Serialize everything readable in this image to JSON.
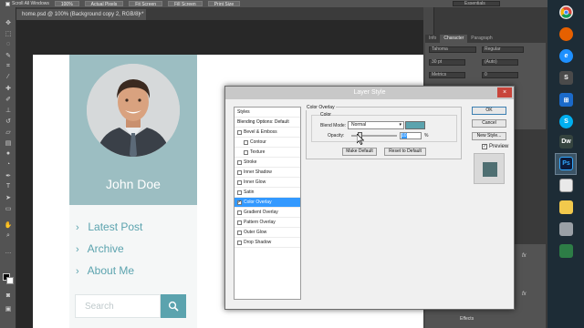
{
  "options_bar": {
    "scroll_all_windows": "Scroll All Windows",
    "buttons": [
      "100%",
      "Actual Pixels",
      "Fit Screen",
      "Fill Screen",
      "Print Size"
    ],
    "workspace": "Essentials"
  },
  "document_tab": {
    "title": "home.psd @ 100% (Background copy 2, RGB/8) *",
    "close": "×"
  },
  "canvas": {
    "profile_name": "John Doe",
    "nav": [
      "Latest Post",
      "Archive",
      "About Me"
    ],
    "search_placeholder": "Search",
    "accent_color": "#5ba3ae"
  },
  "panels": {
    "tabs": [
      "Info",
      "Character",
      "Paragraph"
    ],
    "font_family": "Tahoma",
    "font_style": "Regular",
    "fields": [
      "30 pt",
      "(Auto)",
      "Metrics",
      "0"
    ],
    "effects_label": "Effects",
    "fx": "fx"
  },
  "dialog": {
    "title": "Layer Style",
    "close": "×",
    "styles": [
      {
        "label": "Styles",
        "checkbox": false,
        "checked": false,
        "indent": false,
        "selected": false
      },
      {
        "label": "Blending Options: Default",
        "checkbox": false,
        "checked": false,
        "indent": false,
        "selected": false
      },
      {
        "label": "Bevel & Emboss",
        "checkbox": true,
        "checked": false,
        "indent": false,
        "selected": false
      },
      {
        "label": "Contour",
        "checkbox": true,
        "checked": false,
        "indent": true,
        "selected": false
      },
      {
        "label": "Texture",
        "checkbox": true,
        "checked": false,
        "indent": true,
        "selected": false
      },
      {
        "label": "Stroke",
        "checkbox": true,
        "checked": false,
        "indent": false,
        "selected": false
      },
      {
        "label": "Inner Shadow",
        "checkbox": true,
        "checked": false,
        "indent": false,
        "selected": false
      },
      {
        "label": "Inner Glow",
        "checkbox": true,
        "checked": false,
        "indent": false,
        "selected": false
      },
      {
        "label": "Satin",
        "checkbox": true,
        "checked": false,
        "indent": false,
        "selected": false
      },
      {
        "label": "Color Overlay",
        "checkbox": true,
        "checked": true,
        "indent": false,
        "selected": true
      },
      {
        "label": "Gradient Overlay",
        "checkbox": true,
        "checked": false,
        "indent": false,
        "selected": false
      },
      {
        "label": "Pattern Overlay",
        "checkbox": true,
        "checked": false,
        "indent": false,
        "selected": false
      },
      {
        "label": "Outer Glow",
        "checkbox": true,
        "checked": false,
        "indent": false,
        "selected": false
      },
      {
        "label": "Drop Shadow",
        "checkbox": true,
        "checked": false,
        "indent": false,
        "selected": false
      }
    ],
    "color_overlay": {
      "group_title": "Color Overlay",
      "color_title": "Color",
      "blend_mode_label": "Blend Mode:",
      "blend_mode": "Normal",
      "overlay_color": "#5ba3ae",
      "opacity_label": "Opacity:",
      "opacity_value": "10",
      "opacity_unit": "%",
      "make_default": "Make Default",
      "reset_default": "Reset to Default"
    },
    "ok": "OK",
    "cancel": "Cancel",
    "new_style": "New Style...",
    "preview_label": "Preview",
    "preview_checked": "✓",
    "preview_color": "#4f6f72"
  },
  "taskbar": {
    "icons": [
      "chrome-icon",
      "firefox-icon",
      "ie-icon",
      "sublime-icon",
      "windows-icon",
      "skype-icon",
      "dreamweaver-icon",
      "photoshop-icon",
      "explorer-icon",
      "notes-icon",
      "files-icon",
      "media-icon"
    ],
    "ps_label": "Ps"
  }
}
